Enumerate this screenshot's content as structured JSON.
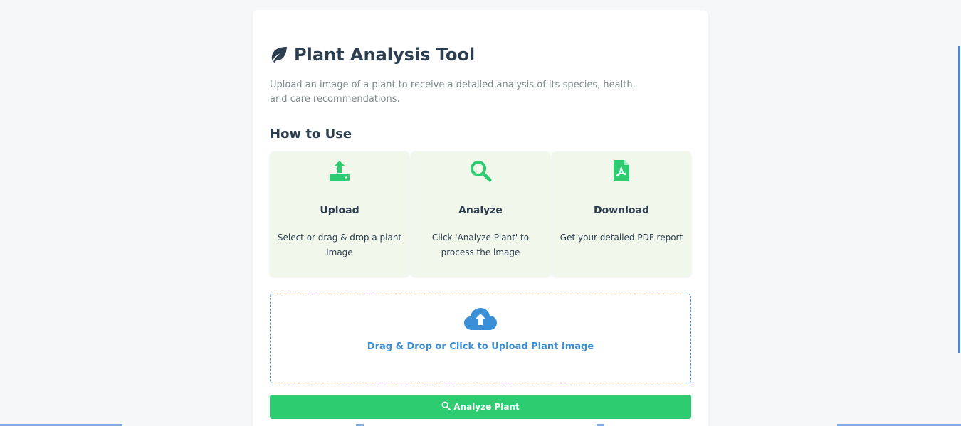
{
  "header": {
    "title": "Plant Analysis Tool",
    "icon": "leaf-icon",
    "subtitle": "Upload an image of a plant to receive a detailed analysis of its species, health, and care recommendations."
  },
  "how_to": {
    "heading": "How to Use",
    "steps": [
      {
        "icon": "upload-icon",
        "title": "Upload",
        "description": "Select or drag & drop a plant image"
      },
      {
        "icon": "search-icon",
        "title": "Analyze",
        "description": "Click 'Analyze Plant' to process the image"
      },
      {
        "icon": "pdf-file-icon",
        "title": "Download",
        "description": "Get your detailed PDF report"
      }
    ]
  },
  "upload": {
    "icon": "cloud-upload-icon",
    "label": "Drag & Drop or Click to Upload Plant Image"
  },
  "actions": {
    "analyze_label": "Analyze Plant",
    "analyze_icon": "search-icon"
  },
  "colors": {
    "accent_green": "#2ecc71",
    "accent_blue": "#3a8fd6",
    "title_text": "#2c3e50",
    "step_bg": "#f1f7ea"
  }
}
